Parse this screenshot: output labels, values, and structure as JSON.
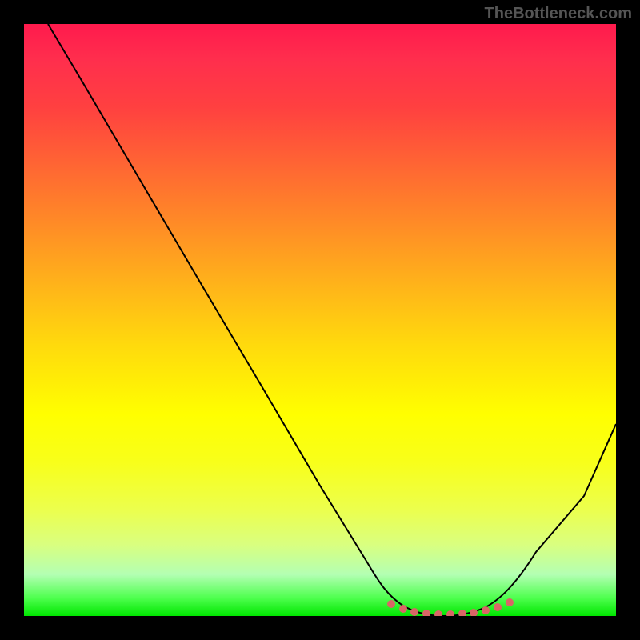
{
  "watermark": "TheBottleneck.com",
  "chart_data": {
    "type": "line",
    "title": "",
    "xlabel": "",
    "ylabel": "",
    "xlim": [
      0,
      100
    ],
    "ylim": [
      0,
      100
    ],
    "series": [
      {
        "name": "bottleneck-curve",
        "x": [
          4,
          10,
          20,
          30,
          40,
          50,
          58,
          62,
          66,
          70,
          74,
          78,
          82,
          86,
          92,
          100
        ],
        "values": [
          100,
          90,
          73,
          56,
          39,
          22,
          9,
          4,
          1,
          0,
          0,
          0,
          1,
          4,
          14,
          33
        ]
      },
      {
        "name": "sweet-spot-dots",
        "x": [
          62,
          64,
          66,
          68,
          70,
          72,
          74,
          76,
          78,
          80,
          82
        ],
        "values": [
          2,
          1.2,
          0.6,
          0.3,
          0.1,
          0.1,
          0.2,
          0.4,
          0.8,
          1.4,
          2.2
        ]
      }
    ],
    "gradient_stops": [
      {
        "pos": 0,
        "color": "#ff1a4d"
      },
      {
        "pos": 66,
        "color": "#ffff00"
      },
      {
        "pos": 100,
        "color": "#00e600"
      }
    ]
  }
}
